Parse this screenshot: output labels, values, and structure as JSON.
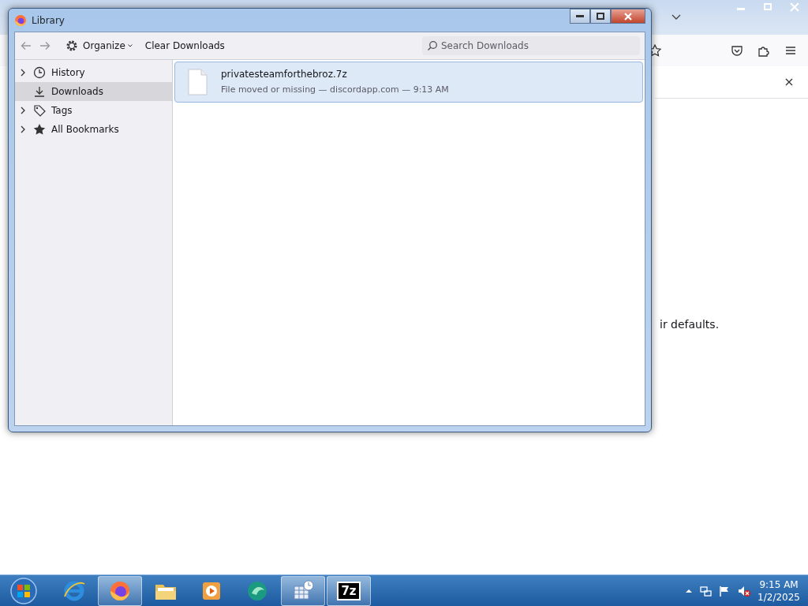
{
  "browser": {
    "notice_text": "ir defaults."
  },
  "library": {
    "title": "Library",
    "organize": "Organize",
    "clear_button": "Clear Downloads",
    "search_placeholder": "Search Downloads",
    "sidebar": [
      {
        "label": "History",
        "expandable": true,
        "selected": false
      },
      {
        "label": "Downloads",
        "expandable": false,
        "selected": true
      },
      {
        "label": "Tags",
        "expandable": true,
        "selected": false
      },
      {
        "label": "All Bookmarks",
        "expandable": true,
        "selected": false
      }
    ],
    "downloads": [
      {
        "name": "privatesteamforthebroz.7z",
        "status": "File moved or missing — discordapp.com — 9:13 AM",
        "selected": true
      }
    ]
  },
  "taskbar": {
    "apps": [
      {
        "kind": "ie",
        "running": false
      },
      {
        "kind": "firefox",
        "running": true
      },
      {
        "kind": "folder",
        "running": false
      },
      {
        "kind": "media",
        "running": false
      },
      {
        "kind": "green",
        "running": false
      },
      {
        "kind": "calendar",
        "running": true
      },
      {
        "kind": "sevenzip",
        "running": true,
        "label": "7z"
      }
    ],
    "time": "9:15 AM",
    "date": "1/2/2025"
  }
}
